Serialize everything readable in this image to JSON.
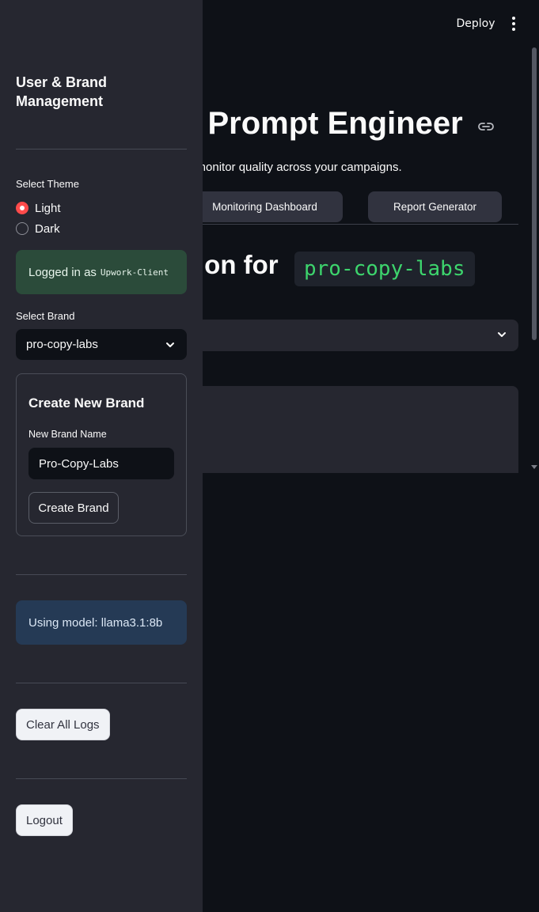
{
  "header": {
    "deploy_label": "Deploy",
    "menu_icon": "kebab-menu-icon"
  },
  "main": {
    "title": "Prompt Engineer",
    "title_prefix_glyph": "-",
    "subtitle": "d monitor quality across your campaigns.",
    "tabs": [
      {
        "label": "Monitoring Dashboard"
      },
      {
        "label": "Report Generator"
      }
    ],
    "heading_text": "tion for",
    "heading_code": "pro-copy-labs"
  },
  "sidebar": {
    "title": "User & Brand Management",
    "theme": {
      "label": "Select Theme",
      "options": [
        "Light",
        "Dark"
      ],
      "selected": "Light"
    },
    "login": {
      "prefix": "Logged in as",
      "username": "Upwork-Client"
    },
    "brand": {
      "label": "Select Brand",
      "selected": "pro-copy-labs"
    },
    "create_brand": {
      "title": "Create New Brand",
      "name_label": "New Brand Name",
      "name_value": "Pro-Copy-Labs",
      "button_label": "Create Brand"
    },
    "model_info": "Using model: llama3.1:8b",
    "clear_logs_label": "Clear All Logs",
    "logout_label": "Logout"
  },
  "colors": {
    "background": "#0e1117",
    "sidebar": "#262730",
    "accent": "#ff4b4b",
    "code_green": "#3dd56d",
    "success_bg": "#2b4b3a",
    "info_bg": "#253a55"
  }
}
